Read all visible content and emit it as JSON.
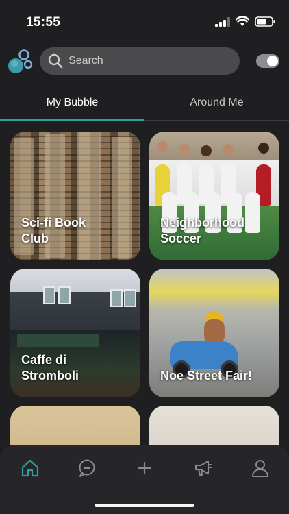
{
  "status_bar": {
    "time": "15:55"
  },
  "header": {
    "search_placeholder": "Search",
    "toggle_on": true,
    "brand_colors": {
      "accent": "#2aa0a4",
      "logo_teal": "#3d9aa6",
      "logo_blue": "#7fb3df"
    }
  },
  "tabs": [
    {
      "label": "My Bubble",
      "active": true
    },
    {
      "label": "Around Me",
      "active": false
    }
  ],
  "cards": [
    {
      "title": "Sci-fi Book\nClub"
    },
    {
      "title": "Neighborhood\nSoccer"
    },
    {
      "title": "Caffe di\nStromboli"
    },
    {
      "title": "Noe Street Fair!"
    },
    {
      "title": ""
    },
    {
      "title": ""
    }
  ],
  "bottom_nav": [
    {
      "icon": "home-icon",
      "active": true
    },
    {
      "icon": "chat-bubble-icon",
      "active": false
    },
    {
      "icon": "plus-icon",
      "active": false
    },
    {
      "icon": "megaphone-icon",
      "active": false
    },
    {
      "icon": "profile-icon",
      "active": false
    }
  ]
}
